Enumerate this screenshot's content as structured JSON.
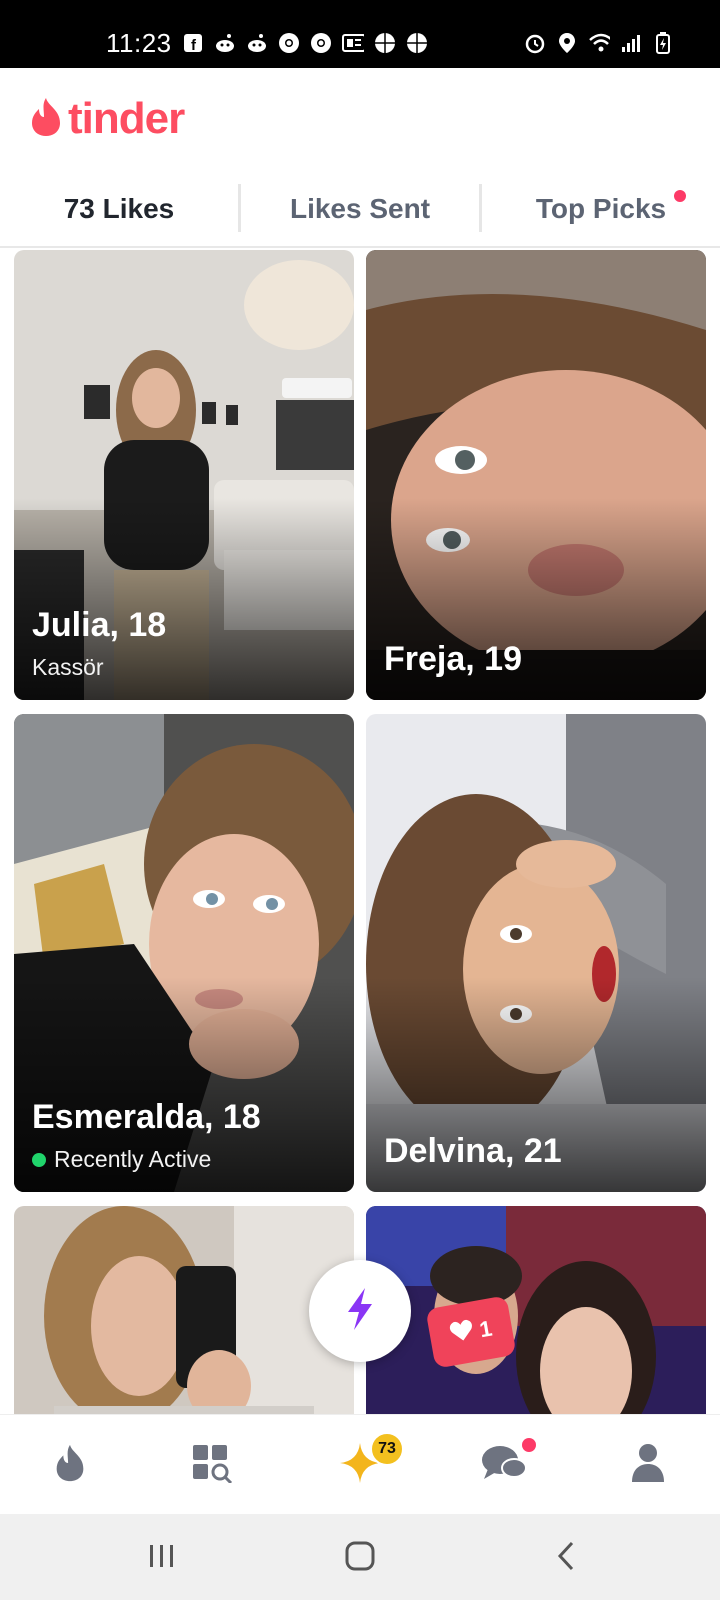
{
  "status_bar": {
    "time": "11:23",
    "left_icons": [
      "facebook-icon",
      "reddit-icon",
      "reddit-icon",
      "chrome-icon",
      "chrome-icon",
      "news-icon",
      "basketball-icon",
      "basketball-icon"
    ],
    "right_icons": [
      "alarm-icon",
      "location-icon",
      "wifi-icon",
      "signal-icon",
      "battery-icon"
    ]
  },
  "header": {
    "logo_text": "tinder",
    "brand_color": "#fd4d61"
  },
  "tabs": [
    {
      "label": "73 Likes",
      "active": true
    },
    {
      "label": "Likes Sent",
      "active": false
    },
    {
      "label": "Top Picks",
      "active": false,
      "has_dot": true
    }
  ],
  "cards": [
    {
      "name": "Julia, 18",
      "subtitle": "Kassör",
      "subtitle_type": "job"
    },
    {
      "name": "Freja, 19"
    },
    {
      "name": "Esmeralda, 18",
      "subtitle": "Recently Active",
      "subtitle_type": "activity"
    },
    {
      "name": "Delvina, 21"
    },
    {
      "name": ""
    },
    {
      "name": "",
      "like_count": "1"
    }
  ],
  "boost_button": {
    "icon": "lightning-bolt-icon"
  },
  "bottom_nav": {
    "items": [
      "flame-icon",
      "explore-icon",
      "likes-star-icon",
      "chat-icon",
      "profile-icon"
    ],
    "likes_badge": "73",
    "active": "likes-star-icon"
  },
  "system_nav": {
    "items": [
      "recent-apps-icon",
      "home-icon",
      "back-icon"
    ]
  },
  "colors": {
    "accent": "#fd4d61",
    "badge_gold": "#f3c01f",
    "active_dot": "#20d46b",
    "boost_purple": "#8a35f5"
  }
}
